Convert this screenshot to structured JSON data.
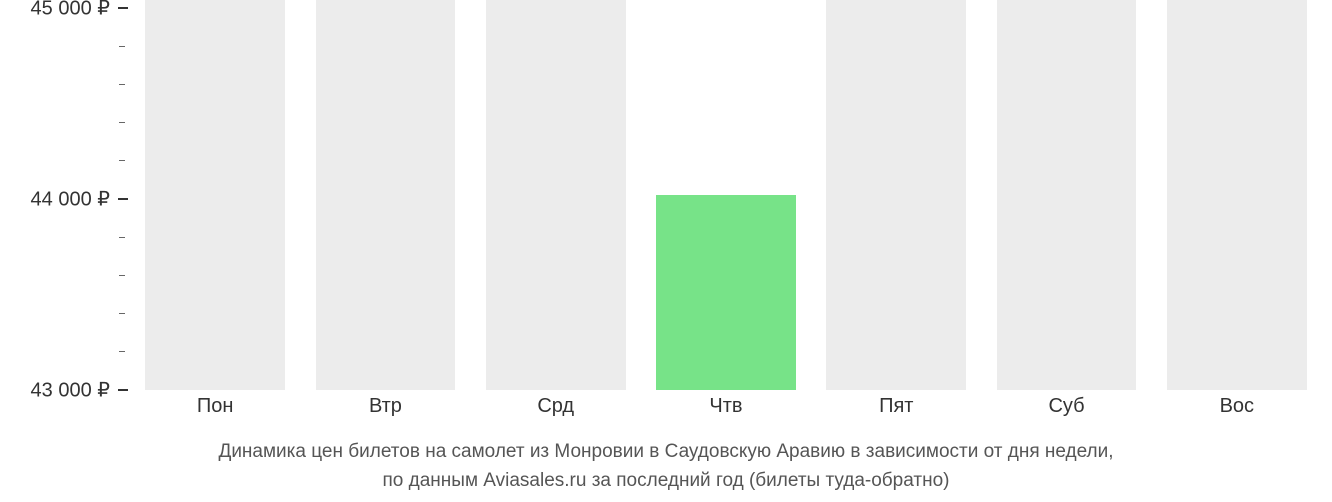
{
  "chart_data": {
    "type": "bar",
    "categories": [
      "Пон",
      "Втр",
      "Срд",
      "Чтв",
      "Пят",
      "Суб",
      "Вос"
    ],
    "values": [
      null,
      null,
      null,
      44000,
      null,
      null,
      null
    ],
    "highlighted_index": 3,
    "ylim": [
      43000,
      45000
    ],
    "y_ticks": [
      {
        "value": 43000,
        "label": "43 000 ₽"
      },
      {
        "value": 44000,
        "label": "44 000 ₽"
      },
      {
        "value": 45000,
        "label": "45 000 ₽"
      }
    ],
    "y_minor_ticks": [
      43200,
      43400,
      43600,
      43800,
      44200,
      44400,
      44600,
      44800
    ],
    "caption_line1": "Динамика цен билетов на самолет из Монровии в Саудовскую Аравию в зависимости от дня недели,",
    "caption_line2": "по данным Aviasales.ru за последний год (билеты туда-обратно)"
  }
}
